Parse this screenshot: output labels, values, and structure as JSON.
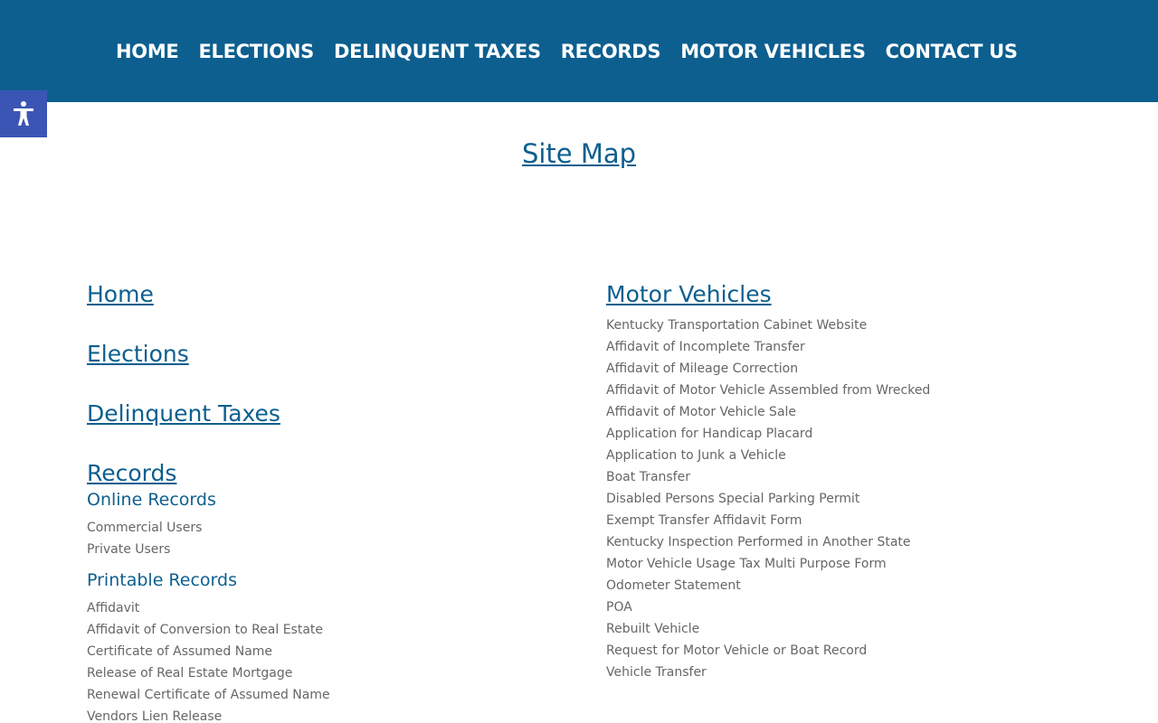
{
  "nav": {
    "items": [
      "HOME",
      "ELECTIONS",
      "DELINQUENT TAXES",
      "RECORDS",
      "MOTOR VEHICLES",
      "CONTACT US"
    ]
  },
  "accessibility": {
    "icon": "accessibility-icon",
    "color": "#3b55b4"
  },
  "page": {
    "title": "Site Map"
  },
  "left": {
    "home": "Home",
    "elections": "Elections",
    "delinquent_taxes": "Delinquent Taxes",
    "records": "Records",
    "online_records": {
      "title": "Online Records",
      "items": [
        "Commercial Users",
        "Private Users"
      ]
    },
    "printable_records": {
      "title": "Printable Records",
      "items": [
        "Affidavit",
        "Affidavit of Conversion to Real Estate",
        "Certificate of Assumed Name",
        "Release of Real Estate Mortgage",
        "Renewal Certificate of Assumed Name",
        "Vendors Lien Release"
      ]
    }
  },
  "right": {
    "motor_vehicles": "Motor Vehicles",
    "items": [
      "Kentucky Transportation Cabinet Website",
      "Affidavit of Incomplete Transfer",
      "Affidavit of Mileage Correction",
      "Affidavit of Motor Vehicle Assembled from Wrecked",
      "Affidavit of Motor Vehicle Sale",
      "Application for Handicap Placard",
      "Application to Junk a Vehicle",
      "Boat Transfer",
      "Disabled Persons Special Parking Permit",
      "Exempt Transfer Affidavit Form",
      "Kentucky Inspection Performed in Another State",
      "Motor Vehicle Usage Tax Multi Purpose Form",
      "Odometer Statement",
      "POA",
      "Rebuilt Vehicle",
      "Request for Motor Vehicle or Boat Record",
      "Vehicle Transfer"
    ]
  },
  "colors": {
    "header_bg": "#0d5f8f",
    "link": "#0d5f8f",
    "text": "#666666"
  }
}
